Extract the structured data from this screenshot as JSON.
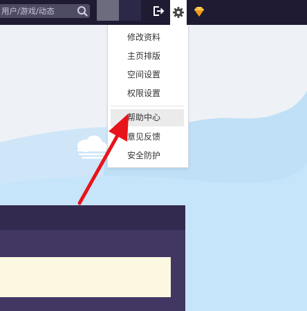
{
  "topbar": {
    "search": {
      "placeholder": "用户/游戏/动态",
      "value": ""
    },
    "icons": {
      "search": "search-icon",
      "logout": "logout-icon",
      "settings": "gear-icon",
      "vip": "diamond-icon"
    }
  },
  "settings_menu": {
    "items": [
      {
        "label": "修改资料"
      },
      {
        "label": "主页排版"
      },
      {
        "label": "空间设置"
      },
      {
        "label": "权限设置"
      },
      {
        "label": "帮助中心",
        "highlighted": true
      },
      {
        "label": "意见反馈"
      },
      {
        "label": "安全防护"
      }
    ]
  },
  "colors": {
    "topbar": "#1e1b33",
    "panel": "#423663",
    "panel_header": "#332a50",
    "note_box": "#fcf7e1",
    "annotation_arrow": "#e8141b",
    "menu_highlight": "#ebebeb"
  }
}
